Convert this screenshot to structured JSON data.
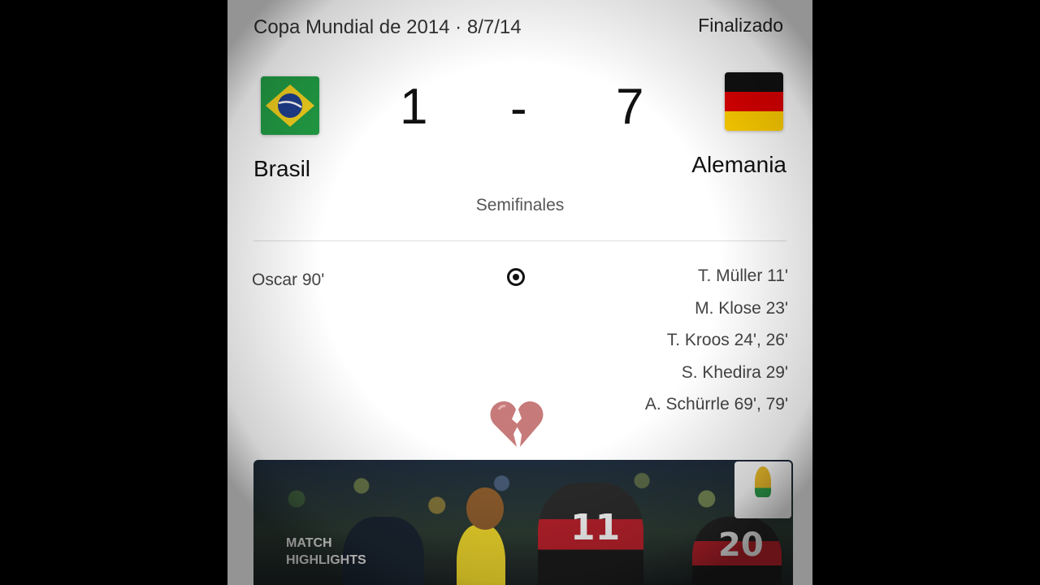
{
  "match": {
    "competition_date": "Copa Mundial de 2014 · 8/7/14",
    "status": "Finalizado",
    "home": {
      "name": "Brasil",
      "score": "1",
      "flag": "brazil-flag-icon"
    },
    "separator": "-",
    "away": {
      "name": "Alemania",
      "score": "7",
      "flag": "germany-flag-icon"
    },
    "stage": "Semifinales"
  },
  "goals": {
    "icon": "soccer-ball-icon",
    "home": [
      "Oscar 90'"
    ],
    "away": [
      "T. Müller 11'",
      "M. Klose 23'",
      "T. Kroos 24', 26'",
      "S. Khedira 29'",
      "A. Schürrle 69', 79'"
    ]
  },
  "reaction": {
    "icon": "broken-heart-icon",
    "color": "#d98a8a"
  },
  "highlights": {
    "label_line1": "MATCH",
    "label_line2": "HIGHLIGHTS",
    "jersey_numbers": [
      "11",
      "20"
    ],
    "logo": "world-cup-2014-logo"
  },
  "colors": {
    "brazil_green": "#229e45",
    "brazil_yellow": "#f4d21f",
    "brazil_blue": "#1f3f8f",
    "germany_black": "#111111",
    "germany_red": "#dd0000",
    "germany_gold": "#ffce00"
  }
}
